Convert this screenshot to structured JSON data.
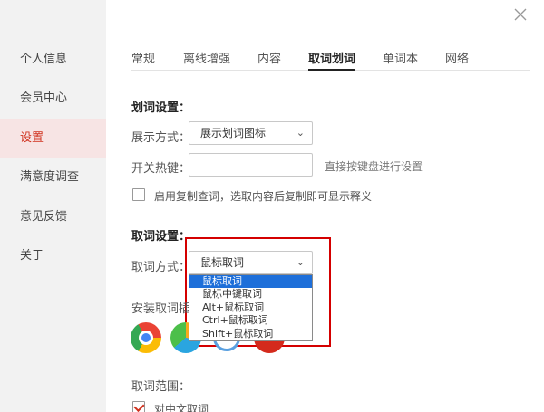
{
  "sidebar": {
    "items": [
      {
        "label": "个人信息",
        "active": false
      },
      {
        "label": "会员中心",
        "active": false
      },
      {
        "label": "设置",
        "active": true
      },
      {
        "label": "满意度调查",
        "active": false
      },
      {
        "label": "意见反馈",
        "active": false
      },
      {
        "label": "关于",
        "active": false
      }
    ]
  },
  "window": {
    "close_icon": "close-icon"
  },
  "tabs": [
    {
      "label": "常规",
      "active": false
    },
    {
      "label": "离线增强",
      "active": false
    },
    {
      "label": "内容",
      "active": false
    },
    {
      "label": "取词划词",
      "active": true
    },
    {
      "label": "单词本",
      "active": false
    },
    {
      "label": "网络",
      "active": false
    }
  ],
  "highlight_section": {
    "title": "划词设置：",
    "display_mode_label": "展示方式：",
    "display_mode_value": "展示划词图标",
    "hotkey_label": "开关热键：",
    "hotkey_value": "",
    "hotkey_hint": "直接按键盘进行设置",
    "copy_lookup_label": "启用复制查词，选取内容后复制即可显示释义",
    "copy_lookup_checked": false
  },
  "lookup_section": {
    "title": "取词设置：",
    "mode_label": "取词方式：",
    "mode_value": "鼠标取词",
    "mode_options": [
      "鼠标取词",
      "鼠标中键取词",
      "Alt+鼠标取词",
      "Ctrl+鼠标取词",
      "Shift+鼠标取词"
    ],
    "selected_option_index": 0,
    "plugin_label": "安装取词插",
    "browsers": [
      "chrome-icon",
      "browser-icon",
      "browser-icon",
      "browser-icon"
    ],
    "range_label": "取词范围：",
    "chinese_lookup_label": "对中文取词",
    "chinese_lookup_checked": true
  },
  "colors": {
    "accent": "#d0321f",
    "highlight_border": "#d40000",
    "selected_option_bg": "#1e6fd9",
    "sidebar_bg": "#f2f2f2",
    "sidebar_active_bg": "#f7e4e4"
  }
}
